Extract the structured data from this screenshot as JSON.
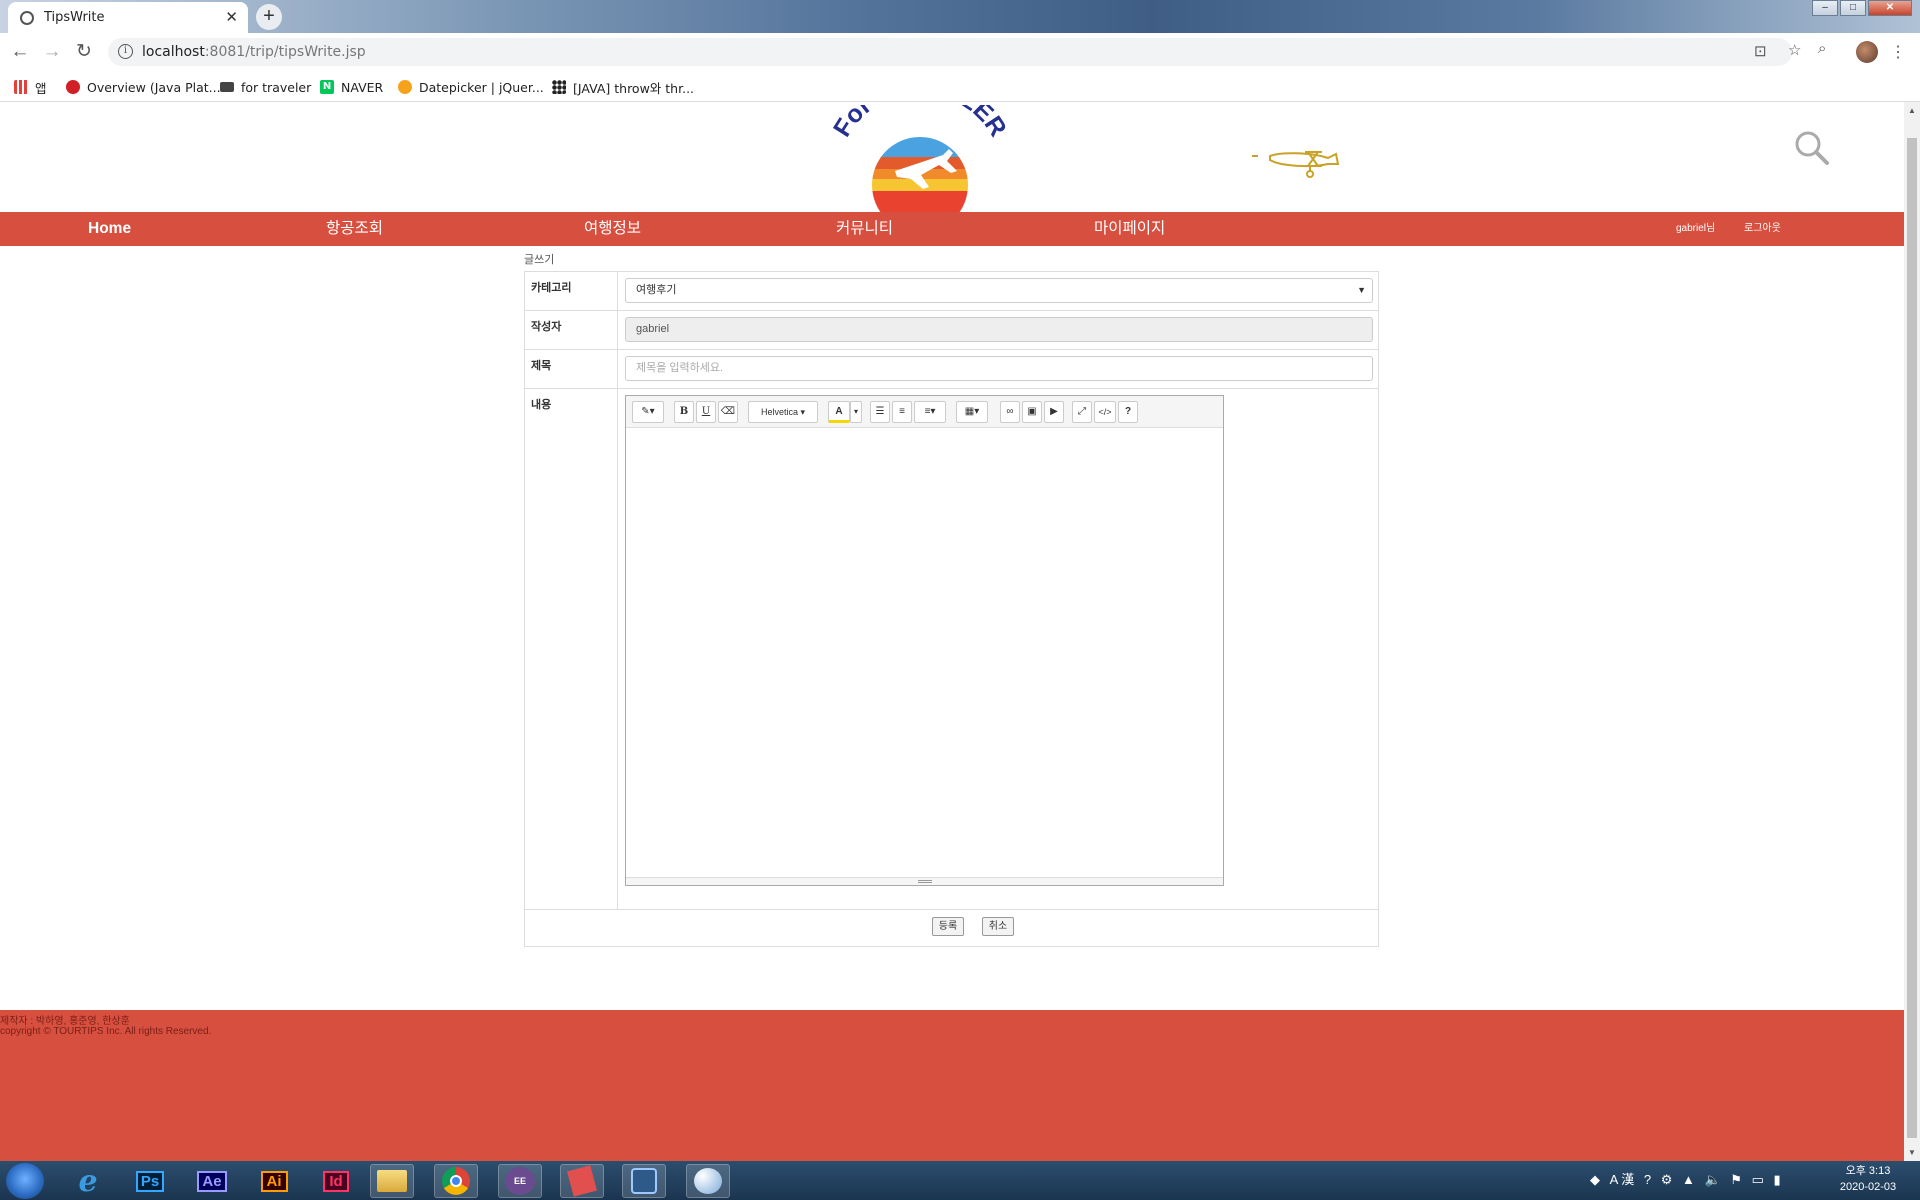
{
  "browser": {
    "tab_title": "TipsWrite",
    "new_tab": "+",
    "url_host": "localhost",
    "url_rest": ":8081/trip/tipsWrite.jsp",
    "window_controls": [
      "–",
      "□",
      "✕"
    ],
    "bookmarks": [
      {
        "label": "앱",
        "color": "#e5413a"
      },
      {
        "label": "Overview (Java Plat...",
        "color": "#d11f26"
      },
      {
        "label": "for traveler",
        "color": "#444444"
      },
      {
        "label": "NAVER",
        "color": "#03c75a"
      },
      {
        "label": "Datepicker | jQuer...",
        "color": "#f7a21d"
      },
      {
        "label": "[JAVA] throw와 thr...",
        "color": "#222222"
      }
    ]
  },
  "header": {
    "logo_text": "For TRAVELER"
  },
  "nav": {
    "items": [
      "Home",
      "항공조회",
      "여행정보",
      "커뮤니티",
      "마이페이지"
    ],
    "user_label": "gabriel님",
    "logout_label": "로그아웃",
    "bar_color": "#d74f3f"
  },
  "breadcrumb": "글쓰기",
  "form": {
    "category_label": "카테고리",
    "category_value": "여행후기",
    "writer_label": "작성자",
    "writer_value": "gabriel",
    "title_label": "제목",
    "title_placeholder": "제목을 입력하세요.",
    "content_label": "내용",
    "font_name": "Helvetica",
    "submit_label": "등록",
    "cancel_label": "취소"
  },
  "footer": {
    "authors": "제작자 : 박하영, 홍준영, 한상훈",
    "copyright": "copyright © TOURTIPS Inc. All rights Reserved."
  },
  "taskbar": {
    "apps": [
      {
        "name": "ie",
        "label": "e",
        "color": "#3a9be0"
      },
      {
        "name": "photoshop",
        "label": "Ps",
        "color": "#31a8ff"
      },
      {
        "name": "after-effects",
        "label": "Ae",
        "color": "#9999ff"
      },
      {
        "name": "illustrator",
        "label": "Ai",
        "color": "#ff9a00"
      },
      {
        "name": "indesign",
        "label": "Id",
        "color": "#ff3366"
      }
    ],
    "ime": "A 漢",
    "clock_time": "오후 3:13",
    "clock_date": "2020-02-03"
  }
}
